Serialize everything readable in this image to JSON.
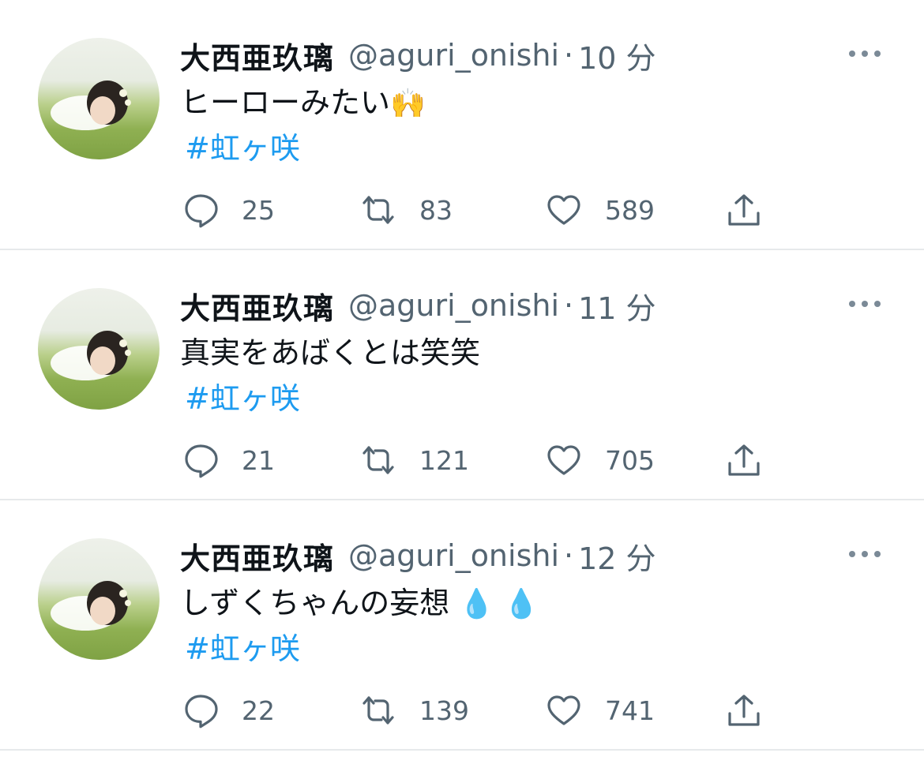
{
  "tweets": [
    {
      "author": "大西亜玖璃",
      "handle": "@aguri_onishi",
      "separator": "·",
      "time": "10 分",
      "text": "ヒーローみたい",
      "emoji": "🙌",
      "hashtag": "#虹ヶ咲",
      "replies": "25",
      "retweets": "83",
      "likes": "589"
    },
    {
      "author": "大西亜玖璃",
      "handle": "@aguri_onishi",
      "separator": "·",
      "time": "11 分",
      "text": "真実をあばくとは笑笑",
      "emoji": "",
      "hashtag": "#虹ヶ咲",
      "replies": "21",
      "retweets": "121",
      "likes": "705"
    },
    {
      "author": "大西亜玖璃",
      "handle": "@aguri_onishi",
      "separator": "·",
      "time": "12 分",
      "text": "しずくちゃんの妄想",
      "emoji": "💧 💧",
      "hashtag": "#虹ヶ咲",
      "replies": "22",
      "retweets": "139",
      "likes": "741"
    }
  ],
  "icons": {
    "more": "more-dots-icon",
    "reply": "reply-bubble-icon",
    "retweet": "retweet-icon",
    "like": "heart-icon",
    "share": "share-upload-icon"
  },
  "colors": {
    "link": "#1d9bf0",
    "secondary_text": "#536471",
    "primary_text": "#0f1419",
    "divider": "#e6e9eb"
  }
}
